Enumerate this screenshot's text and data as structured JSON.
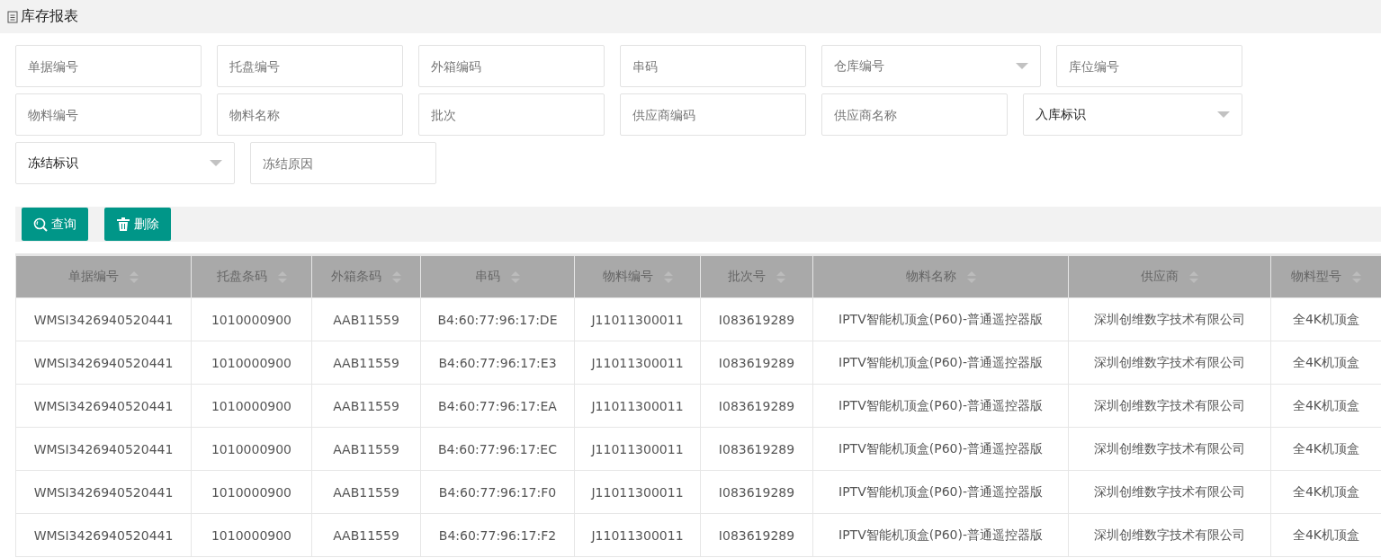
{
  "page_title": "库存报表",
  "filters": [
    [
      {
        "kind": "input",
        "placeholder": "单据编号"
      },
      {
        "kind": "input",
        "placeholder": "托盘编号"
      },
      {
        "kind": "input",
        "placeholder": "外箱编码"
      },
      {
        "kind": "input",
        "placeholder": "串码"
      },
      {
        "kind": "select",
        "placeholder": "仓库编号"
      },
      {
        "kind": "input",
        "placeholder": "库位编号"
      }
    ],
    [
      {
        "kind": "input",
        "placeholder": "物料编号"
      },
      {
        "kind": "input",
        "placeholder": "物料名称"
      },
      {
        "kind": "input",
        "placeholder": "批次"
      },
      {
        "kind": "input",
        "placeholder": "供应商编码"
      },
      {
        "kind": "input",
        "placeholder": "供应商名称"
      },
      {
        "kind": "select",
        "value": "入库标识"
      }
    ],
    [
      {
        "kind": "select",
        "value": "冻结标识"
      },
      {
        "kind": "input",
        "placeholder": "冻结原因"
      }
    ]
  ],
  "buttons": [
    {
      "kind": "search",
      "label": "查询"
    },
    {
      "kind": "delete",
      "label": "删除"
    }
  ],
  "table": {
    "columns": [
      "单据编号",
      "托盘条码",
      "外箱条码",
      "串码",
      "物料编号",
      "批次号",
      "物料名称",
      "供应商",
      "物料型号"
    ],
    "rows": [
      [
        "WMSI3426940520441",
        "1010000900",
        "AAB11559",
        "B4:60:77:96:17:DE",
        "J11011300011",
        "I083619289",
        "IPTV智能机顶盒(P60)-普通遥控器版",
        "深圳创维数字技术有限公司",
        "全4K机顶盒"
      ],
      [
        "WMSI3426940520441",
        "1010000900",
        "AAB11559",
        "B4:60:77:96:17:E3",
        "J11011300011",
        "I083619289",
        "IPTV智能机顶盒(P60)-普通遥控器版",
        "深圳创维数字技术有限公司",
        "全4K机顶盒"
      ],
      [
        "WMSI3426940520441",
        "1010000900",
        "AAB11559",
        "B4:60:77:96:17:EA",
        "J11011300011",
        "I083619289",
        "IPTV智能机顶盒(P60)-普通遥控器版",
        "深圳创维数字技术有限公司",
        "全4K机顶盒"
      ],
      [
        "WMSI3426940520441",
        "1010000900",
        "AAB11559",
        "B4:60:77:96:17:EC",
        "J11011300011",
        "I083619289",
        "IPTV智能机顶盒(P60)-普通遥控器版",
        "深圳创维数字技术有限公司",
        "全4K机顶盒"
      ],
      [
        "WMSI3426940520441",
        "1010000900",
        "AAB11559",
        "B4:60:77:96:17:F0",
        "J11011300011",
        "I083619289",
        "IPTV智能机顶盒(P60)-普通遥控器版",
        "深圳创维数字技术有限公司",
        "全4K机顶盒"
      ],
      [
        "WMSI3426940520441",
        "1010000900",
        "AAB11559",
        "B4:60:77:96:17:F2",
        "J11011300011",
        "I083619289",
        "IPTV智能机顶盒(P60)-普通遥控器版",
        "深圳创维数字技术有限公司",
        "全4K机顶盒"
      ]
    ]
  }
}
